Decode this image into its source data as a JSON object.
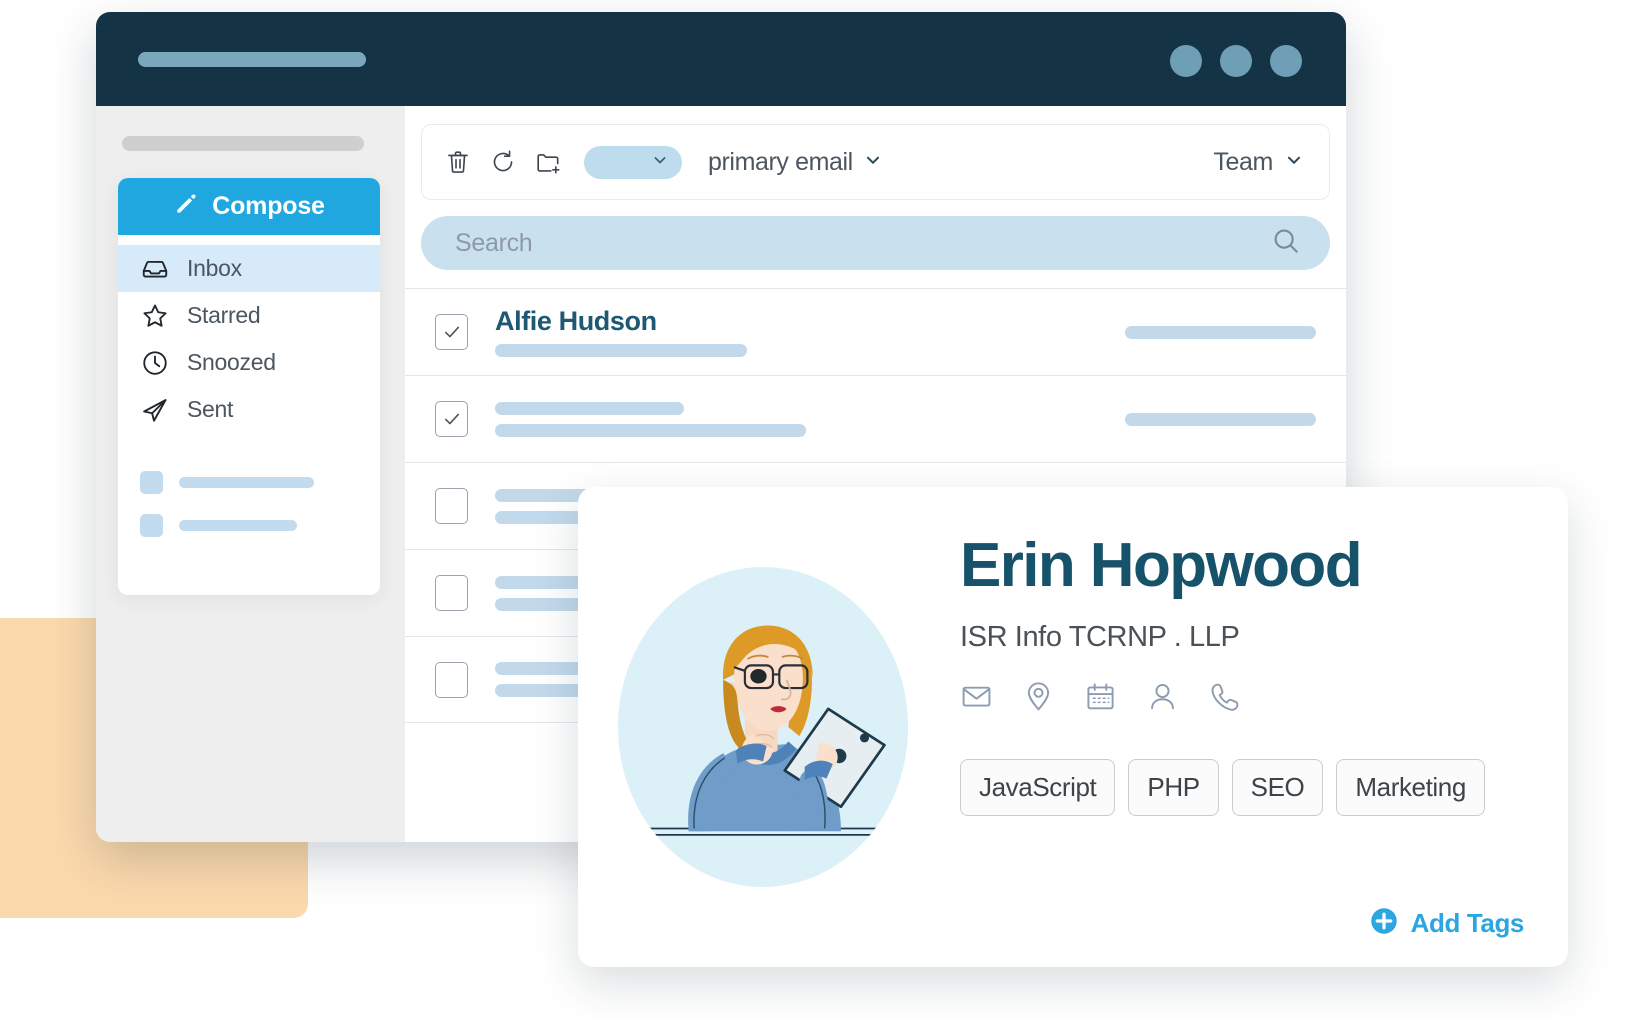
{
  "window": {
    "title_placeholder": "",
    "dots": [
      "window-dot-1",
      "window-dot-2",
      "window-dot-3"
    ]
  },
  "sidebar": {
    "compose": {
      "label": "Compose",
      "icon": "pencil-icon"
    },
    "items": [
      {
        "label": "Inbox",
        "icon": "inbox-icon",
        "active": true
      },
      {
        "label": "Starred",
        "icon": "star-icon",
        "active": false
      },
      {
        "label": "Snoozed",
        "icon": "clock-icon",
        "active": false
      },
      {
        "label": "Sent",
        "icon": "send-icon",
        "active": false
      }
    ],
    "placeholder_rows": [
      {
        "width": 135
      },
      {
        "width": 118
      }
    ]
  },
  "toolbar": {
    "icons": [
      "trash-icon",
      "refresh-icon",
      "new-folder-icon"
    ],
    "select_pill": {
      "value": "",
      "icon": "chevron-down-icon"
    },
    "category_dropdown": {
      "label": "primary email",
      "icon": "chevron-down-icon"
    },
    "team_dropdown": {
      "label": "Team",
      "icon": "chevron-down-icon"
    }
  },
  "search": {
    "placeholder": "Search",
    "value": "",
    "icon": "search-icon"
  },
  "mail_list": {
    "rows": [
      {
        "checked": true,
        "sender": "Alfie Hudson",
        "subject_ghost_width": 252,
        "preview_ghost_width": 0,
        "date_ghost_width": 191
      },
      {
        "checked": true,
        "sender": "",
        "subject_ghost_width": 189,
        "preview_ghost_width": 311,
        "date_ghost_width": 191
      },
      {
        "checked": false,
        "sender": "",
        "subject_ghost_width": 189,
        "preview_ghost_width": 150,
        "date_ghost_width": 191
      },
      {
        "checked": false,
        "sender": "",
        "subject_ghost_width": 132,
        "preview_ghost_width": 132,
        "date_ghost_width": 0
      },
      {
        "checked": false,
        "sender": "",
        "subject_ghost_width": 132,
        "preview_ghost_width": 132,
        "date_ghost_width": 0
      }
    ]
  },
  "contact_card": {
    "avatar": "woman-with-tablet-illustration",
    "name": "Erin Hopwood",
    "company": "ISR Info TCRNP . LLP",
    "action_icons": [
      "envelope-icon",
      "location-pin-icon",
      "calendar-icon",
      "person-icon",
      "phone-icon"
    ],
    "tags": [
      "JavaScript",
      "PHP",
      "SEO",
      "Marketing"
    ],
    "add_tags": {
      "label": "Add Tags",
      "icon": "plus-circle-icon"
    }
  },
  "colors": {
    "titlebar": "#143446",
    "accent_blue": "#20a7e0",
    "active_nav": "#d6eafa",
    "ghost_blue": "#c2d9ec",
    "search_bg": "#c9e0ef",
    "name_teal": "#17526b",
    "deco_orange": "#fcd9ac"
  }
}
